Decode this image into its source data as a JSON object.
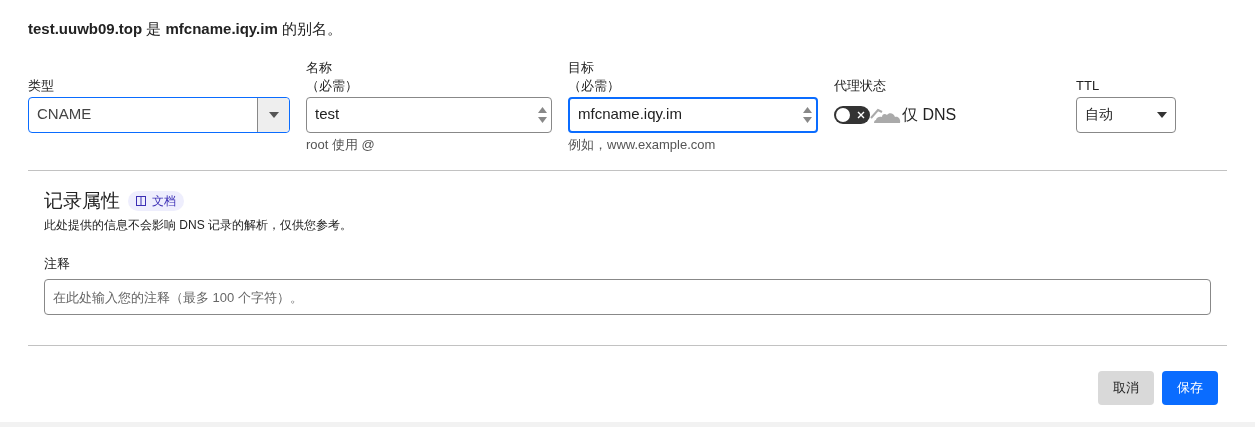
{
  "heading": "**test.uuwb09.top** 是 **mfcname.iqy.im** 的别名。",
  "fields": [
    {
      "kind": "select",
      "label": "类型",
      "value": "CNAME",
      "focused": false
    },
    {
      "kind": "number",
      "label": "名称",
      "label2": "（必需）",
      "value": "test",
      "hint": "root 使用 @",
      "focused": false
    },
    {
      "kind": "number",
      "label": "目标",
      "label2": "（必需）",
      "value": "mfcname.iqy.im",
      "hint": "例如，www.example.com",
      "focused": true
    },
    {
      "kind": "proxy",
      "label": "代理状态",
      "on": false,
      "status": "仅 DNS"
    },
    {
      "kind": "select-small",
      "label": "TTL",
      "value": "自动",
      "focused": false
    }
  ],
  "record_attributes": {
    "title": "记录属性",
    "docs_link": "文档",
    "description": "此处提供的信息不会影响 DNS 记录的解析，仅供您参考。",
    "comment_label": "注释",
    "comment_placeholder": "在此处输入您的注释（最多 100 个字符）。"
  },
  "buttons": [
    {
      "label": "取消",
      "kind": "secondary"
    },
    {
      "label": "保存",
      "kind": "primary"
    }
  ]
}
